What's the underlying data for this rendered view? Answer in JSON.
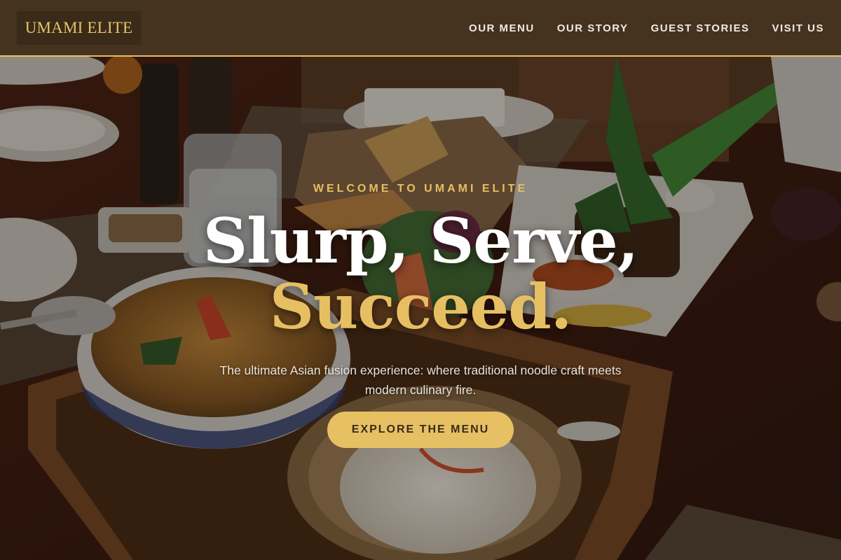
{
  "brand": {
    "logo_text": "UMAMI ELITE"
  },
  "nav": {
    "items": [
      {
        "label": "OUR MENU"
      },
      {
        "label": "OUR STORY"
      },
      {
        "label": "GUEST STORIES"
      },
      {
        "label": "VISIT US"
      }
    ]
  },
  "hero": {
    "eyebrow": "WELCOME TO UMAMI ELITE",
    "headline_line1": "Slurp, Serve,",
    "headline_line2": "Succeed.",
    "subtitle": "The ultimate Asian fusion experience: where traditional noodle craft meets modern culinary fire.",
    "cta_label": "EXPLORE THE MENU"
  },
  "colors": {
    "header_bg": "#45321f",
    "accent_gold": "#e6c063",
    "logo_box_bg": "#3a2a19",
    "nav_text": "#f1ebe2"
  }
}
